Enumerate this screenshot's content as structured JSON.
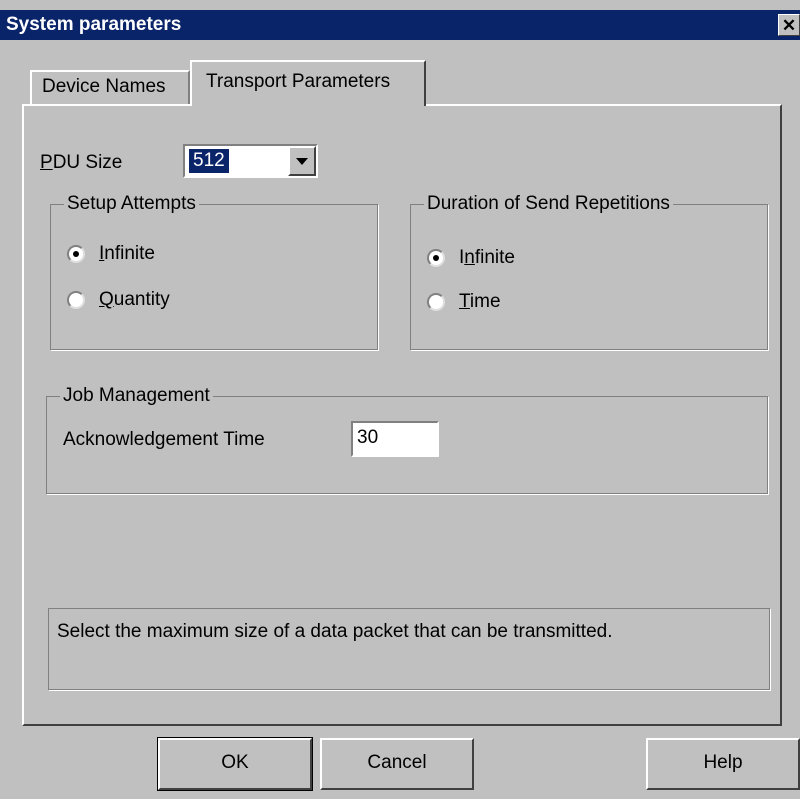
{
  "window": {
    "title": "System parameters",
    "close_symbol": "✕"
  },
  "tabs": [
    {
      "label": "Device Names",
      "selected": false
    },
    {
      "label": "Transport Parameters",
      "selected": true
    }
  ],
  "pdu": {
    "label": "PDU Size",
    "selected_value": "512"
  },
  "setup_attempts": {
    "title": "Setup Attempts",
    "options": [
      {
        "label": "Infinite",
        "checked": true
      },
      {
        "label": "Quantity",
        "checked": false
      }
    ]
  },
  "send_repetitions": {
    "title": "Duration of Send Repetitions",
    "options": [
      {
        "label": "Infinite",
        "checked": true
      },
      {
        "label": "Time",
        "checked": false
      }
    ]
  },
  "job_management": {
    "title": "Job Management",
    "ack_label": "Acknowledgement Time",
    "ack_value": "30"
  },
  "description": "Select the maximum size of a data packet that can be transmitted.",
  "buttons": {
    "ok": "OK",
    "cancel": "Cancel",
    "help": "Help"
  },
  "colors": {
    "titlebar": "#0a246a",
    "face": "#c0c0c0",
    "selection": "#0a246a"
  }
}
